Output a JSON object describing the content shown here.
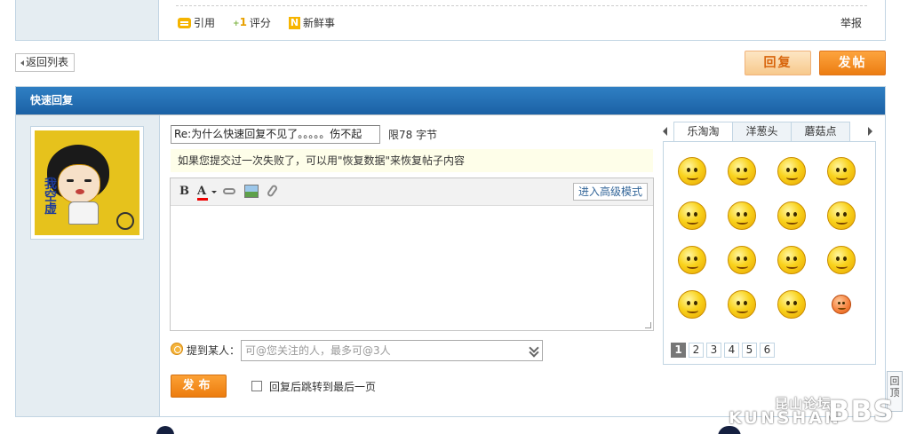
{
  "post_actions": {
    "quote": "引用",
    "rate": "评分",
    "news": "新鲜事",
    "report": "举报"
  },
  "nav": {
    "back": "返回列表",
    "reply": "回复",
    "post": "发帖"
  },
  "quick_reply": {
    "title": "快速回复",
    "subject_value": "Re:为什么快速回复不见了。。。。。伤不起",
    "limit": "限78 字节",
    "notice": "如果您提交过一次失败了，可以用\"恢复数据\"来恢复帖子内容",
    "advanced_mode": "进入高级模式",
    "mention_label": "提到某人：",
    "mention_placeholder": "可@您关注的人，最多可@3人",
    "submit": "发布",
    "jump_label": "回复后跳转到最后一页",
    "jump_checked": false
  },
  "avatar": {
    "text": "我空虚"
  },
  "smilies": {
    "tabs": [
      "乐淘淘",
      "洋葱头",
      "蘑菇点"
    ],
    "active_tab": 0,
    "pages": [
      "1",
      "2",
      "3",
      "4",
      "5",
      "6"
    ],
    "active_page": 0
  },
  "back_to_top": "回顶",
  "watermark": {
    "cn": "昆山论坛",
    "en": "KUNSHAN",
    "bbs": "BBS"
  },
  "colors": {
    "header_blue": "#1f66ab",
    "accent_orange": "#ec7d12",
    "panel_bg": "#e5edf2",
    "border": "#c2d5e3"
  }
}
